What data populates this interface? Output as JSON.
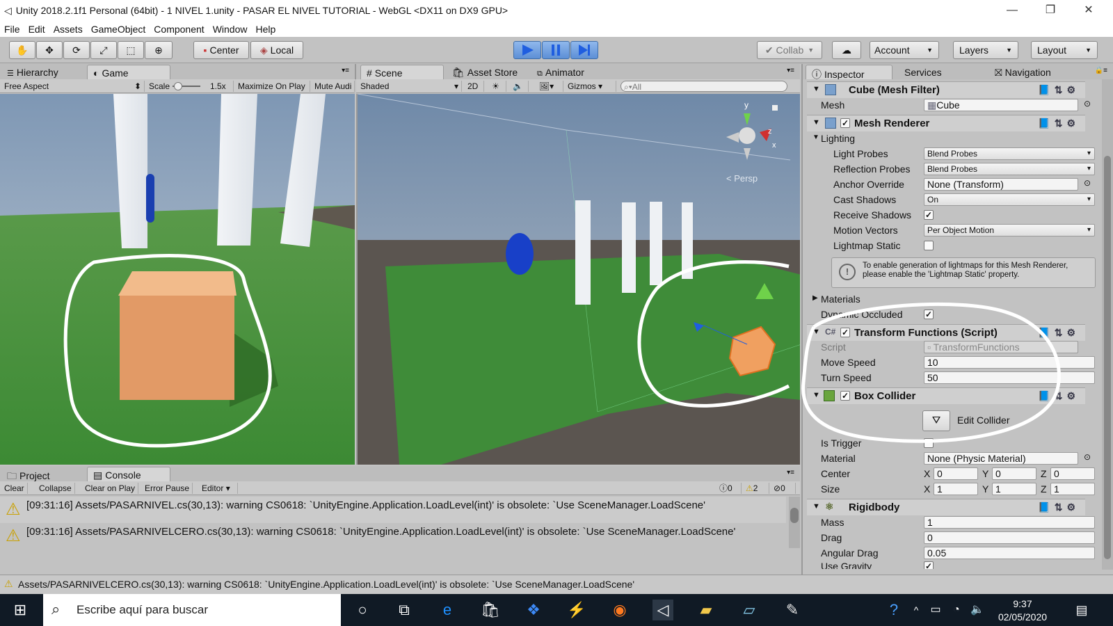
{
  "window": {
    "title": "Unity 2018.2.1f1 Personal (64bit) - 1 NIVEL 1.unity - PASAR EL NIVEL TUTORIAL - WebGL <DX11 on DX9 GPU>",
    "min": "—",
    "max": "❐",
    "close": "✕"
  },
  "menu": [
    "File",
    "Edit",
    "Assets",
    "GameObject",
    "Component",
    "Window",
    "Help"
  ],
  "toolbar": {
    "center": "Center",
    "local": "Local",
    "collab": "Collab",
    "account": "Account",
    "layers": "Layers",
    "layout": "Layout",
    "play_icon": "play-icon",
    "pause_icon": "pause-icon",
    "step_icon": "step-icon"
  },
  "tabs": {
    "hierarchy": "Hierarchy",
    "game": "Game",
    "scene": "Scene",
    "asset_store": "Asset Store",
    "animator": "Animator",
    "inspector": "Inspector",
    "services": "Services",
    "navigation": "Navigation",
    "project": "Project",
    "console": "Console"
  },
  "game_bar": {
    "aspect": "Free Aspect",
    "scale_label": "Scale",
    "scale_value": "1.5x",
    "maximize": "Maximize On Play",
    "mute": "Mute Audi"
  },
  "scene_bar": {
    "shading": "Shaded",
    "mode2d": "2D",
    "gizmos": "Gizmos",
    "search_placeholder": "All"
  },
  "scene_gizmo": {
    "persp": "< Persp",
    "y": "y",
    "z": "z",
    "x": "x"
  },
  "inspector": {
    "mesh_filter": {
      "title": "Cube (Mesh Filter)",
      "mesh_label": "Mesh",
      "mesh_value": "Cube"
    },
    "mesh_renderer": {
      "title": "Mesh Renderer",
      "lighting": "Lighting",
      "light_probes": "Light Probes",
      "light_probes_val": "Blend Probes",
      "reflection_probes": "Reflection Probes",
      "reflection_probes_val": "Blend Probes",
      "anchor_override": "Anchor Override",
      "anchor_override_val": "None (Transform)",
      "cast_shadows": "Cast Shadows",
      "cast_shadows_val": "On",
      "receive_shadows": "Receive Shadows",
      "motion_vectors": "Motion Vectors",
      "motion_vectors_val": "Per Object Motion",
      "lightmap_static": "Lightmap Static",
      "info": "To enable generation of lightmaps for this Mesh Renderer, please enable the 'Lightmap Static' property.",
      "materials": "Materials",
      "dynamic_occluded": "Dynamic Occluded"
    },
    "transform_functions": {
      "title": "Transform Functions (Script)",
      "script_label": "Script",
      "script_value": "TransformFunctions",
      "move_speed_label": "Move Speed",
      "move_speed": "10",
      "turn_speed_label": "Turn Speed",
      "turn_speed": "50"
    },
    "box_collider": {
      "title": "Box Collider",
      "edit_collider": "Edit Collider",
      "is_trigger": "Is Trigger",
      "material_label": "Material",
      "material_value": "None (Physic Material)",
      "center_label": "Center",
      "center": {
        "x": "0",
        "y": "0",
        "z": "0"
      },
      "size_label": "Size",
      "size": {
        "x": "1",
        "y": "1",
        "z": "1"
      },
      "x": "X",
      "y": "Y",
      "z": "Z"
    },
    "rigidbody": {
      "title": "Rigidbody",
      "mass_label": "Mass",
      "mass": "1",
      "drag_label": "Drag",
      "drag": "0",
      "angular_drag_label": "Angular Drag",
      "angular_drag": "0.05",
      "use_gravity_label": "Use Gravity"
    }
  },
  "console": {
    "clear": "Clear",
    "collapse": "Collapse",
    "clear_on_play": "Clear on Play",
    "error_pause": "Error Pause",
    "editor": "Editor",
    "info_count": "0",
    "warn_count": "2",
    "error_count": "0",
    "lines": [
      "[09:31:16] Assets/PASARNIVEL.cs(30,13): warning CS0618: `UnityEngine.Application.LoadLevel(int)' is obsolete: `Use SceneManager.LoadScene'",
      "[09:31:16] Assets/PASARNIVELCERO.cs(30,13): warning CS0618: `UnityEngine.Application.LoadLevel(int)' is obsolete: `Use SceneManager.LoadScene'"
    ]
  },
  "status_bar": "Assets/PASARNIVELCERO.cs(30,13): warning CS0618: `UnityEngine.Application.LoadLevel(int)' is obsolete: `Use SceneManager.LoadScene'",
  "taskbar": {
    "search_placeholder": "Escribe aquí para buscar",
    "time": "9:37",
    "date": "02/05/2020"
  }
}
